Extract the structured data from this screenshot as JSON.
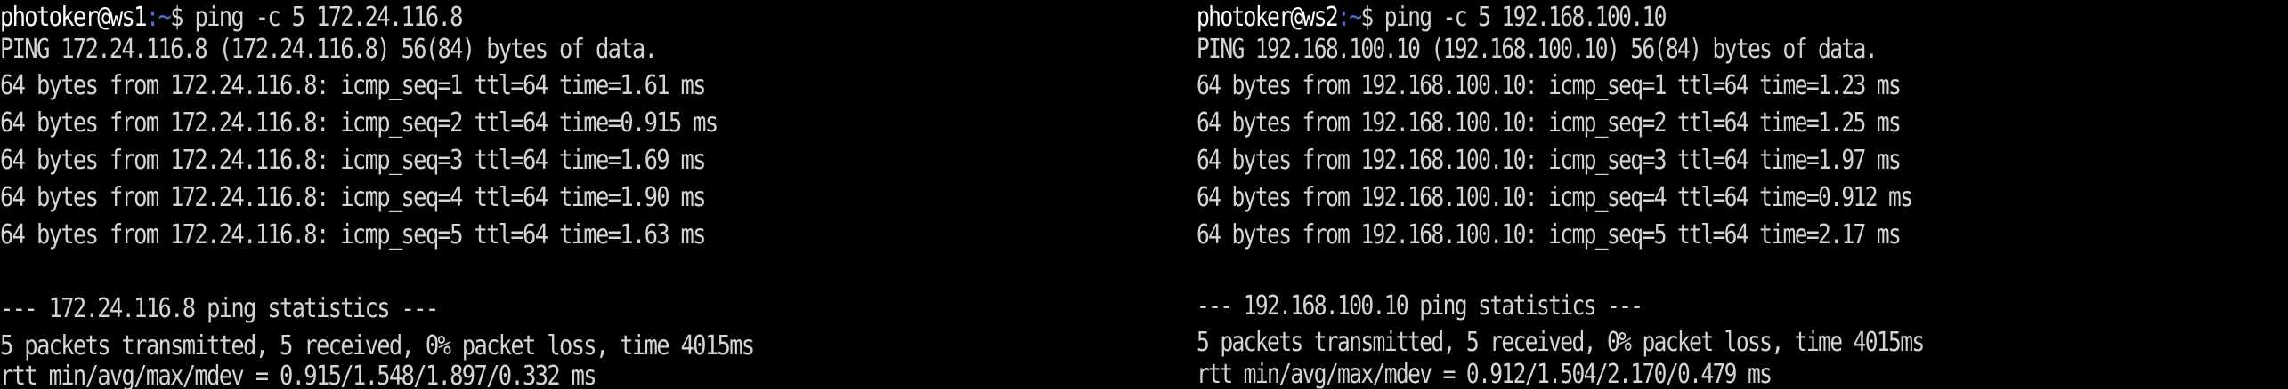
{
  "left_terminal": {
    "prompt": {
      "user_host": "photoker@ws1",
      "path": ":~",
      "symbol": "$ "
    },
    "command": "ping -c 5 172.24.116.8",
    "header": "PING 172.24.116.8 (172.24.116.8) 56(84) bytes of data.",
    "replies": [
      "64 bytes from 172.24.116.8: icmp_seq=1 ttl=64 time=1.61 ms",
      "64 bytes from 172.24.116.8: icmp_seq=2 ttl=64 time=0.915 ms",
      "64 bytes from 172.24.116.8: icmp_seq=3 ttl=64 time=1.69 ms",
      "64 bytes from 172.24.116.8: icmp_seq=4 ttl=64 time=1.90 ms",
      "64 bytes from 172.24.116.8: icmp_seq=5 ttl=64 time=1.63 ms"
    ],
    "stats_header": "--- 172.24.116.8 ping statistics ---",
    "stats_summary": "5 packets transmitted, 5 received, 0% packet loss, time 4015ms",
    "stats_rtt": "rtt min/avg/max/mdev = 0.915/1.548/1.897/0.332 ms"
  },
  "right_terminal": {
    "prompt": {
      "user_host": "photoker@ws2",
      "path": ":~",
      "symbol": "$ "
    },
    "command": "ping -c 5 192.168.100.10",
    "header": "PING 192.168.100.10 (192.168.100.10) 56(84) bytes of data.",
    "replies": [
      "64 bytes from 192.168.100.10: icmp_seq=1 ttl=64 time=1.23 ms",
      "64 bytes from 192.168.100.10: icmp_seq=2 ttl=64 time=1.25 ms",
      "64 bytes from 192.168.100.10: icmp_seq=3 ttl=64 time=1.97 ms",
      "64 bytes from 192.168.100.10: icmp_seq=4 ttl=64 time=0.912 ms",
      "64 bytes from 192.168.100.10: icmp_seq=5 ttl=64 time=2.17 ms"
    ],
    "stats_header": "--- 192.168.100.10 ping statistics ---",
    "stats_summary": "5 packets transmitted, 5 received, 0% packet loss, time 4015ms",
    "stats_rtt": "rtt min/avg/max/mdev = 0.912/1.504/2.170/0.479 ms"
  },
  "colors": {
    "background": "#000000",
    "text": "#d4d4d4",
    "prompt_user": "#ffffff",
    "prompt_path": "#4a6fd6"
  }
}
